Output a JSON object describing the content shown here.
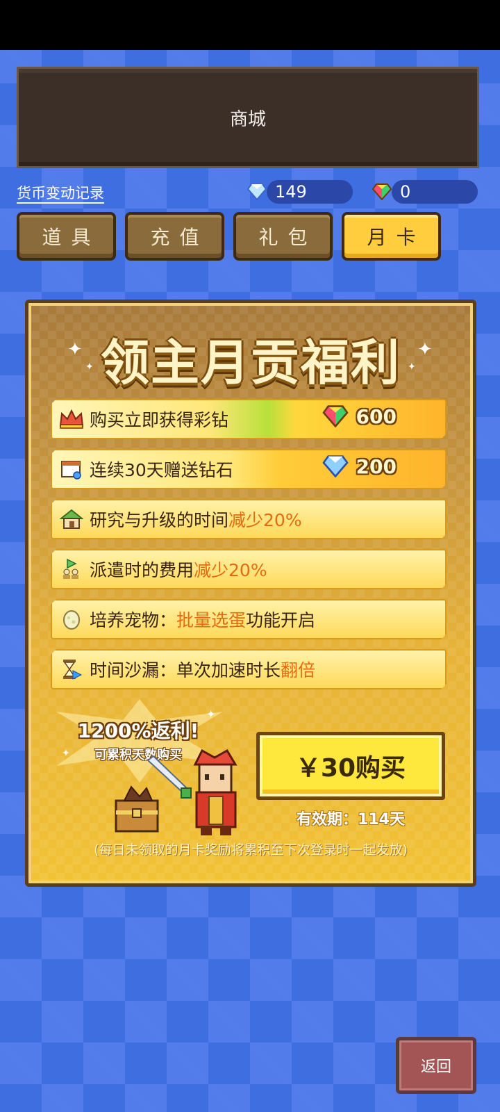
{
  "header": {
    "title": "商城"
  },
  "currency": {
    "history_link": "货币变动记录",
    "diamonds": "149",
    "rainbow_diamonds": "0"
  },
  "tabs": [
    {
      "label": "道具",
      "active": false
    },
    {
      "label": "充值",
      "active": false
    },
    {
      "label": "礼包",
      "active": false
    },
    {
      "label": "月卡",
      "active": true
    }
  ],
  "card": {
    "title": "领主月贡福利",
    "benefits": [
      {
        "icon": "crown-icon",
        "text": "购买立即获得彩钻",
        "reward_icon": "rainbow-diamond-icon",
        "reward_value": "600"
      },
      {
        "icon": "calendar-icon",
        "text": "连续30天赠送钻石",
        "reward_icon": "diamond-icon",
        "reward_value": "200"
      },
      {
        "icon": "house-icon",
        "text": "研究与升级的时间",
        "highlight": "减少20%"
      },
      {
        "icon": "dispatch-icon",
        "text": "派遣时的费用",
        "highlight": "减少20%"
      },
      {
        "icon": "egg-icon",
        "text_before": "培养宠物：",
        "highlight": "批量选蛋",
        "text_after": "功能开启"
      },
      {
        "icon": "hourglass-icon",
        "text": "时间沙漏：单次加速时长",
        "highlight": "翻倍"
      }
    ],
    "promo_main": "1200%返利!",
    "promo_sub": "可累积天数购买",
    "buy_label": "￥30购买",
    "validity": "有效期：114天",
    "note": "(每日未领取的月卡奖励将累积至下次登录时一起发放)"
  },
  "footer": {
    "back_label": "返回"
  },
  "colors": {
    "accent": "#ffcd3d",
    "highlight": "#e66b10",
    "background": "#3f6ee0"
  }
}
